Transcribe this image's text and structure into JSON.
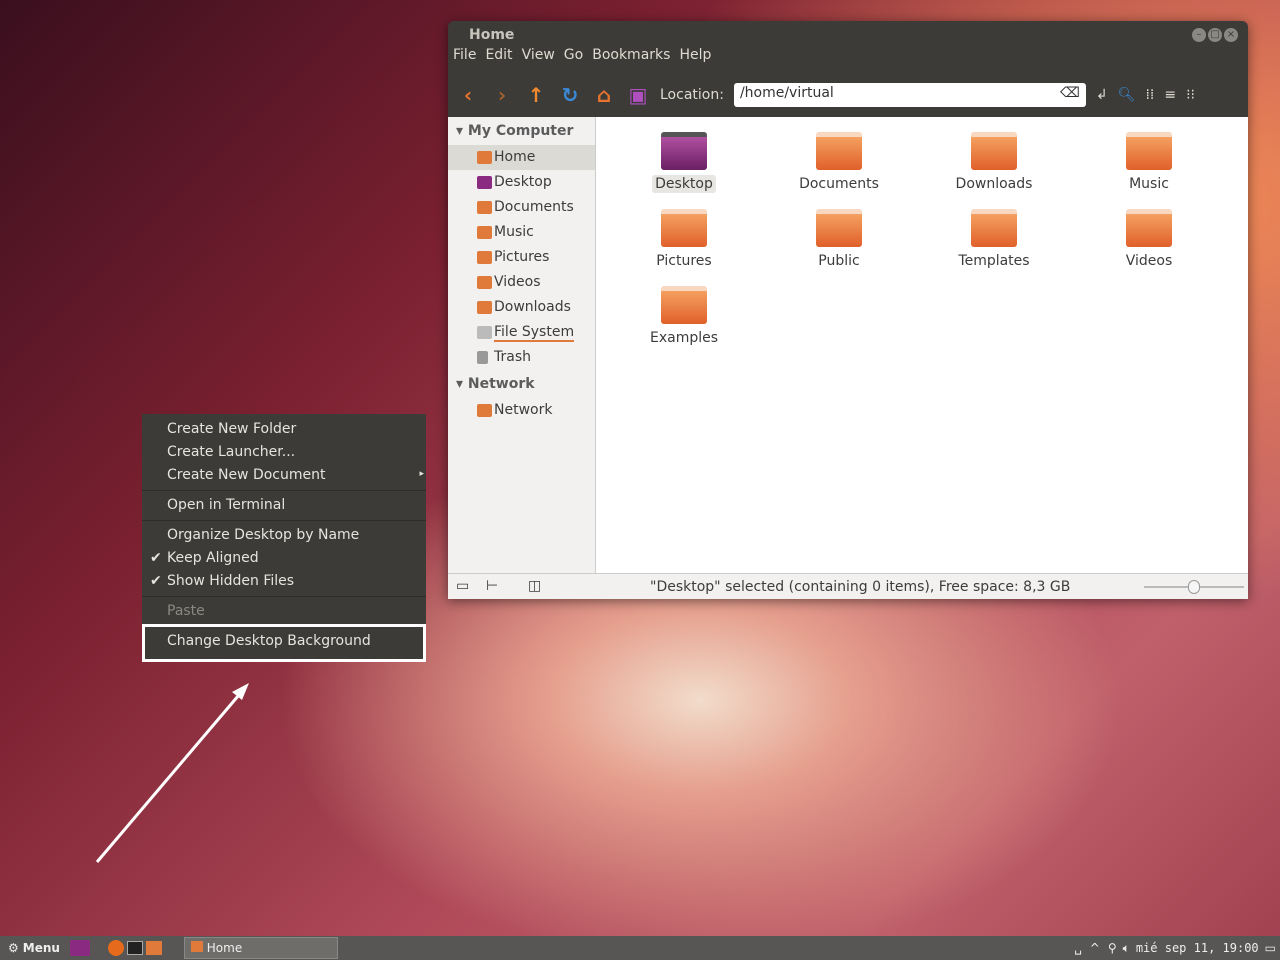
{
  "window": {
    "title": "Home",
    "menu": [
      "File",
      "Edit",
      "View",
      "Go",
      "Bookmarks",
      "Help"
    ],
    "location_label": "Location:",
    "location_value": "/home/virtual"
  },
  "sidebar": {
    "sections": [
      {
        "title": "My Computer",
        "items": [
          "Home",
          "Desktop",
          "Documents",
          "Music",
          "Pictures",
          "Videos",
          "Downloads",
          "File System",
          "Trash"
        ]
      },
      {
        "title": "Network",
        "items": [
          "Network"
        ]
      }
    ],
    "selected": "Home"
  },
  "files": [
    "Desktop",
    "Documents",
    "Downloads",
    "Music",
    "Pictures",
    "Public",
    "Templates",
    "Videos",
    "Examples"
  ],
  "status": "\"Desktop\" selected (containing 0 items), Free space: 8,3 GB",
  "context_menu": {
    "items": [
      "Create New Folder",
      "Create Launcher...",
      "Create New Document",
      "Open in Terminal",
      "Organize Desktop by Name",
      "Keep Aligned",
      "Show Hidden Files",
      "Paste",
      "Change Desktop Background"
    ],
    "checked": [
      "Keep Aligned",
      "Show Hidden Files"
    ],
    "disabled": [
      "Paste"
    ],
    "highlighted": "Change Desktop Background"
  },
  "taskbar": {
    "menu_label": "Menu",
    "task": "Home",
    "clock": "mié sep 11, 19:00"
  }
}
